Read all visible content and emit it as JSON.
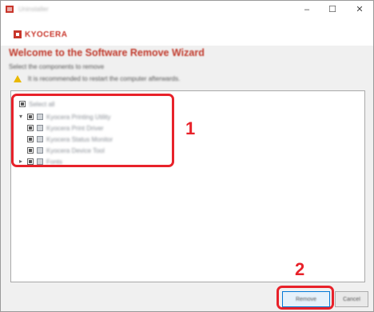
{
  "window": {
    "title": "Uninstaller",
    "controls": {
      "minimize": "–",
      "maximize": "☐",
      "close": "✕"
    }
  },
  "header": {
    "logo_text": "KYOCERA"
  },
  "wizard": {
    "heading": "Welcome to the Software Remove Wizard",
    "subtext": "Select the components to remove",
    "warning": "It is recommended to restart the computer afterwards."
  },
  "tree": {
    "root_label": "Select all",
    "items": [
      {
        "label": "Kyocera Printing Utility"
      },
      {
        "label": "Kyocera Print Driver"
      },
      {
        "label": "Kyocera Status Monitor"
      },
      {
        "label": "Kyocera Device Tool"
      },
      {
        "label": "Fonts"
      }
    ]
  },
  "callouts": {
    "one": "1",
    "two": "2"
  },
  "footer": {
    "remove_label": "Remove",
    "cancel_label": "Cancel"
  },
  "colors": {
    "accent": "#c8362b",
    "callout": "#e8222a"
  }
}
